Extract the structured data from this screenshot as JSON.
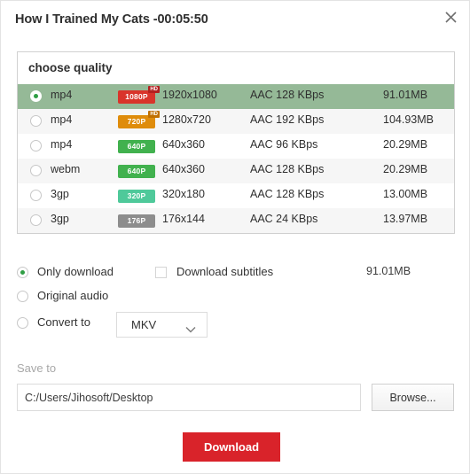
{
  "header": {
    "title": "How I Trained My Cats  -00:05:50",
    "close_icon": "close-icon"
  },
  "quality": {
    "header_label": "choose quality",
    "rows": [
      {
        "format": "mp4",
        "badge": "1080P",
        "badge_color": "#d9342b",
        "hd": "HD",
        "resolution": "1920x1080",
        "audio": "AAC 128 KBps",
        "size": "91.01MB",
        "selected": true
      },
      {
        "format": "mp4",
        "badge": "720P",
        "badge_color": "#df8c0b",
        "hd": "HD",
        "resolution": "1280x720",
        "audio": "AAC 192 KBps",
        "size": "104.93MB",
        "selected": false
      },
      {
        "format": "mp4",
        "badge": "640P",
        "badge_color": "#41b14e",
        "hd": "",
        "resolution": "640x360",
        "audio": "AAC 96 KBps",
        "size": "20.29MB",
        "selected": false
      },
      {
        "format": "webm",
        "badge": "640P",
        "badge_color": "#41b14e",
        "hd": "",
        "resolution": "640x360",
        "audio": "AAC 128 KBps",
        "size": "20.29MB",
        "selected": false
      },
      {
        "format": "3gp",
        "badge": "320P",
        "badge_color": "#4fc99a",
        "hd": "",
        "resolution": "320x180",
        "audio": "AAC 128 KBps",
        "size": "13.00MB",
        "selected": false
      },
      {
        "format": "3gp",
        "badge": "176P",
        "badge_color": "#8d8d8d",
        "hd": "",
        "resolution": "176x144",
        "audio": "AAC 24 KBps",
        "size": "13.97MB",
        "selected": false
      }
    ]
  },
  "options": {
    "only_download_label": "Only download",
    "only_download_selected": true,
    "subtitles_label": "Download subtitles",
    "subtitles_checked": false,
    "total_size": "91.01MB",
    "original_audio_label": "Original audio",
    "original_audio_selected": false,
    "convert_to_label": "Convert to",
    "convert_to_selected": false,
    "convert_format": "MKV",
    "convert_format_options": [
      "MKV"
    ]
  },
  "save": {
    "label": "Save to",
    "path": "C:/Users/Jihosoft/Desktop",
    "browse_label": "Browse..."
  },
  "actions": {
    "download_label": "Download"
  },
  "colors": {
    "accent_red": "#d9232a",
    "selected_row": "#95b997",
    "radio_green": "#2f9e44"
  }
}
